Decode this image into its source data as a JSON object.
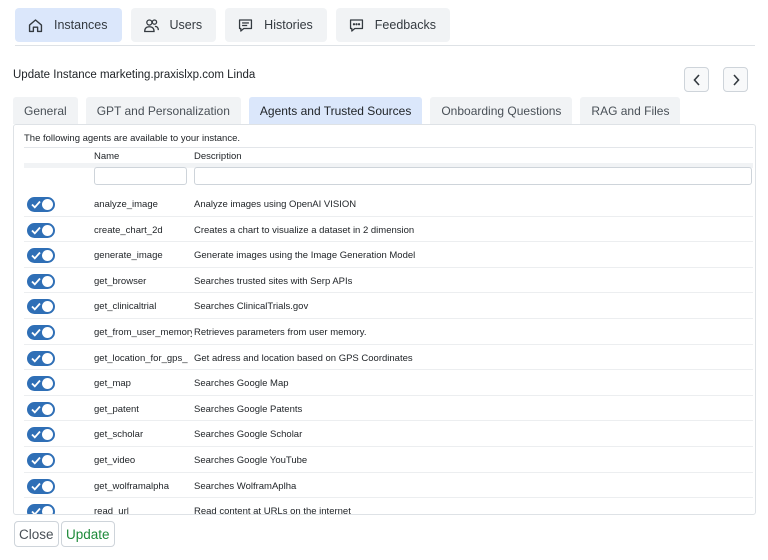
{
  "nav": {
    "items": [
      {
        "id": "instances",
        "label": "Instances",
        "icon": "home-icon",
        "active": true
      },
      {
        "id": "users",
        "label": "Users",
        "icon": "users-icon",
        "active": false
      },
      {
        "id": "histories",
        "label": "Histories",
        "icon": "histories-icon",
        "active": false
      },
      {
        "id": "feedbacks",
        "label": "Feedbacks",
        "icon": "feedback-icon",
        "active": false
      }
    ]
  },
  "page": {
    "title": "Update Instance marketing.praxislxp.com Linda"
  },
  "tabs": [
    {
      "label": "General",
      "active": false
    },
    {
      "label": "GPT and Personalization",
      "active": false
    },
    {
      "label": "Agents and Trusted Sources",
      "active": true
    },
    {
      "label": "Onboarding Questions",
      "active": false
    },
    {
      "label": "RAG and Files",
      "active": false
    }
  ],
  "agents": {
    "intro": "The following agents are available to your instance.",
    "columns": {
      "name": "Name",
      "description": "Description"
    },
    "filter": {
      "name_value": "",
      "description_value": ""
    },
    "rows": [
      {
        "name": "analyze_image",
        "description": "Analyze images using OpenAI VISION",
        "enabled": true
      },
      {
        "name": "create_chart_2d",
        "description": "Creates a chart to visualize a dataset in 2 dimension",
        "enabled": true
      },
      {
        "name": "generate_image",
        "description": "Generate images using the Image Generation Model",
        "enabled": true
      },
      {
        "name": "get_browser",
        "description": "Searches trusted sites with Serp APIs",
        "enabled": true
      },
      {
        "name": "get_clinicaltrial",
        "description": "Searches ClinicalTrials.gov",
        "enabled": true
      },
      {
        "name": "get_from_user_memory",
        "description": "Retrieves parameters from user memory.",
        "enabled": true
      },
      {
        "name": "get_location_for_gps_",
        "description": "Get adress and location based on GPS Coordinates",
        "enabled": true
      },
      {
        "name": "get_map",
        "description": "Searches Google Map",
        "enabled": true
      },
      {
        "name": "get_patent",
        "description": "Searches Google Patents",
        "enabled": true
      },
      {
        "name": "get_scholar",
        "description": "Searches Google Scholar",
        "enabled": true
      },
      {
        "name": "get_video",
        "description": "Searches Google YouTube",
        "enabled": true
      },
      {
        "name": "get_wolframalpha",
        "description": "Searches WolframAplha",
        "enabled": true
      },
      {
        "name": "read_url",
        "description": "Read content at URLs on the internet",
        "enabled": true
      }
    ]
  },
  "footer": {
    "close_label": "Close",
    "update_label": "Update"
  },
  "colors": {
    "accent": "#dbe7fb",
    "toggle_on": "#2f6fb6",
    "update_text": "#1e8a3a"
  }
}
